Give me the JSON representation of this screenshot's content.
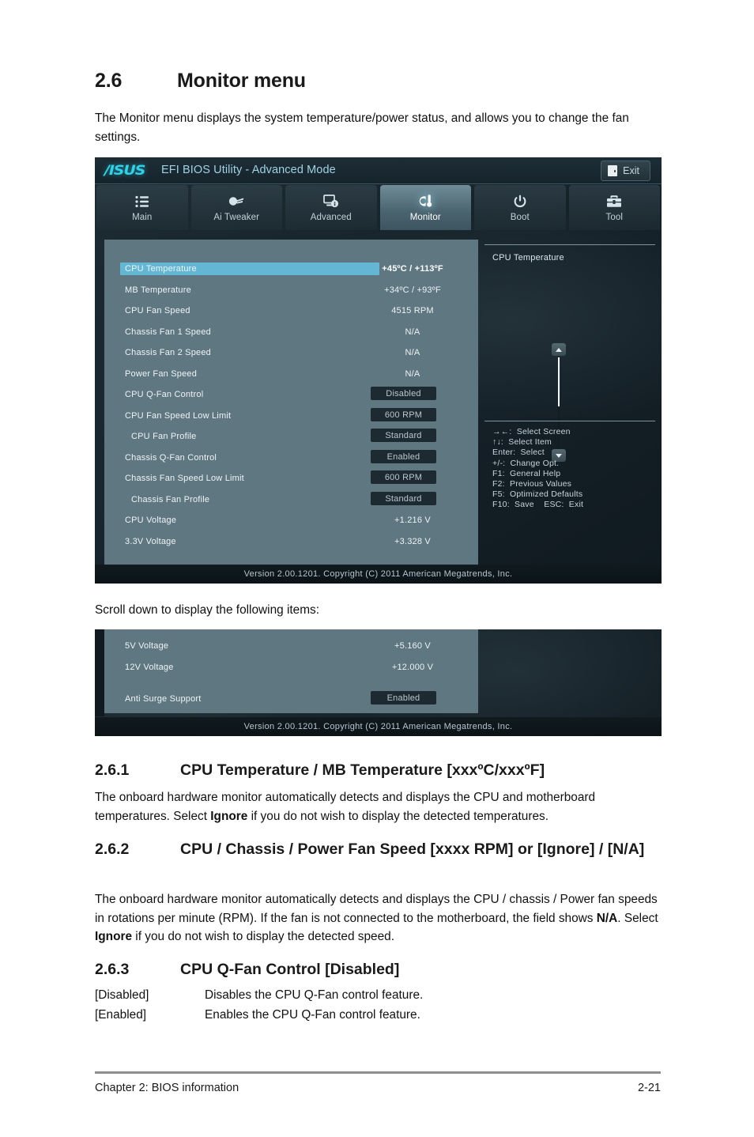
{
  "document": {
    "section_number": "2.6",
    "section_title": "Monitor menu",
    "intro": "The Monitor menu displays the system temperature/power status, and allows you to change the fan settings.",
    "scroll_note": "Scroll down to display the following items:",
    "subsections": [
      {
        "number": "2.6.1",
        "title": "CPU Temperature / MB Temperature [xxxºC/xxxºF]",
        "body_1": "The onboard hardware monitor automatically detects and displays the CPU and motherboard temperatures. Select ",
        "body_bold": "Ignore",
        "body_2": " if you do not wish to display the detected temperatures."
      },
      {
        "number": "2.6.2",
        "title": "CPU / Chassis / Power Fan Speed [xxxx RPM] or [Ignore] / [N/A]",
        "body_1": "The onboard hardware monitor automatically detects and displays the CPU / chassis / Power fan speeds in rotations per minute (RPM). If the fan is not connected to the motherboard, the field shows ",
        "body_bold": "N/A",
        "body_2": ". Select ",
        "body_bold_2": "Ignore",
        "body_3": " if you do not wish to display the detected speed."
      },
      {
        "number": "2.6.3",
        "title": "CPU Q-Fan Control [Disabled]",
        "definitions": [
          {
            "term": "[Disabled]",
            "desc": "Disables the CPU Q-Fan control feature."
          },
          {
            "term": "[Enabled]",
            "desc": "Enables the CPU Q-Fan control feature."
          }
        ]
      }
    ],
    "footer_left": "Chapter 2: BIOS information",
    "footer_right": "2-21"
  },
  "bios": {
    "logo": "/ISUS",
    "title": "EFI BIOS Utility - Advanced Mode",
    "exit_label": "Exit",
    "tabs": [
      {
        "label": "Main",
        "icon": "list-icon",
        "active": false
      },
      {
        "label": "Ai  Tweaker",
        "icon": "tweaker-icon",
        "active": false
      },
      {
        "label": "Advanced",
        "icon": "advanced-icon",
        "active": false
      },
      {
        "label": "Monitor",
        "icon": "thermometer-icon",
        "active": true
      },
      {
        "label": "Boot",
        "icon": "power-icon",
        "active": false
      },
      {
        "label": "Tool",
        "icon": "toolbox-icon",
        "active": false
      }
    ],
    "items": [
      {
        "label": "CPU Temperature",
        "value": "+45ºC / +113ºF",
        "type": "value",
        "highlighted": true,
        "indent": 0,
        "bold": true
      },
      {
        "label": "MB Temperature",
        "value": "+34ºC / +93ºF",
        "type": "value",
        "highlighted": false,
        "indent": 0,
        "bold": false
      },
      {
        "label": "CPU Fan Speed",
        "value": "4515 RPM",
        "type": "value",
        "highlighted": false,
        "indent": 0,
        "bold": false
      },
      {
        "label": "Chassis Fan 1 Speed",
        "value": "N/A",
        "type": "value",
        "highlighted": false,
        "indent": 0,
        "bold": false
      },
      {
        "label": "Chassis Fan 2 Speed",
        "value": "N/A",
        "type": "value",
        "highlighted": false,
        "indent": 0,
        "bold": false
      },
      {
        "label": "Power Fan Speed",
        "value": "N/A",
        "type": "value",
        "highlighted": false,
        "indent": 0,
        "bold": false
      },
      {
        "label": "CPU Q-Fan Control",
        "value": "Disabled",
        "type": "option",
        "highlighted": false,
        "indent": 0,
        "bold": false
      },
      {
        "label": "CPU Fan Speed Low Limit",
        "value": "600 RPM",
        "type": "option",
        "highlighted": false,
        "indent": 0,
        "bold": false
      },
      {
        "label": "CPU Fan Profile",
        "value": "Standard",
        "type": "option",
        "highlighted": false,
        "indent": 1,
        "bold": false
      },
      {
        "label": "Chassis Q-Fan Control",
        "value": "Enabled",
        "type": "option",
        "highlighted": false,
        "indent": 0,
        "bold": false
      },
      {
        "label": "Chassis Fan Speed Low Limit",
        "value": "600 RPM",
        "type": "option",
        "highlighted": false,
        "indent": 0,
        "bold": false
      },
      {
        "label": "Chassis Fan Profile",
        "value": "Standard",
        "type": "option",
        "highlighted": false,
        "indent": 1,
        "bold": false
      },
      {
        "label": "CPU Voltage",
        "value": "+1.216 V",
        "type": "value",
        "highlighted": false,
        "indent": 0,
        "bold": false
      },
      {
        "label": "3.3V Voltage",
        "value": "+3.328 V",
        "type": "value",
        "highlighted": false,
        "indent": 0,
        "bold": false
      }
    ],
    "help": {
      "title": "CPU Temperature",
      "keys": "→←:  Select Screen\n↑↓:  Select Item\nEnter:  Select\n+/-:  Change Opt.\nF1:  General Help\nF2:  Previous Values\nF5:  Optimized Defaults\nF10:  Save    ESC:  Exit"
    },
    "version_footer": "Version  2.00.1201.   Copyright  (C)  2011  American  Megatrends,  Inc."
  },
  "bios2": {
    "items": [
      {
        "label": "5V Voltage",
        "value": "+5.160 V",
        "type": "value"
      },
      {
        "label": "12V Voltage",
        "value": "+12.000 V",
        "type": "value"
      },
      {
        "label": "Anti Surge Support",
        "value": "Enabled",
        "type": "option"
      }
    ],
    "version_footer": "Version  2.00.1201.   Copyright  (C)  2011  American  Megatrends,  Inc."
  },
  "colors": {
    "accent_cyan": "#2fd2e8",
    "highlight_blue": "#63b6d4",
    "panel_slate": "#5e7780",
    "shell_dark": "#18242b",
    "option_box": "#1e2a31"
  }
}
